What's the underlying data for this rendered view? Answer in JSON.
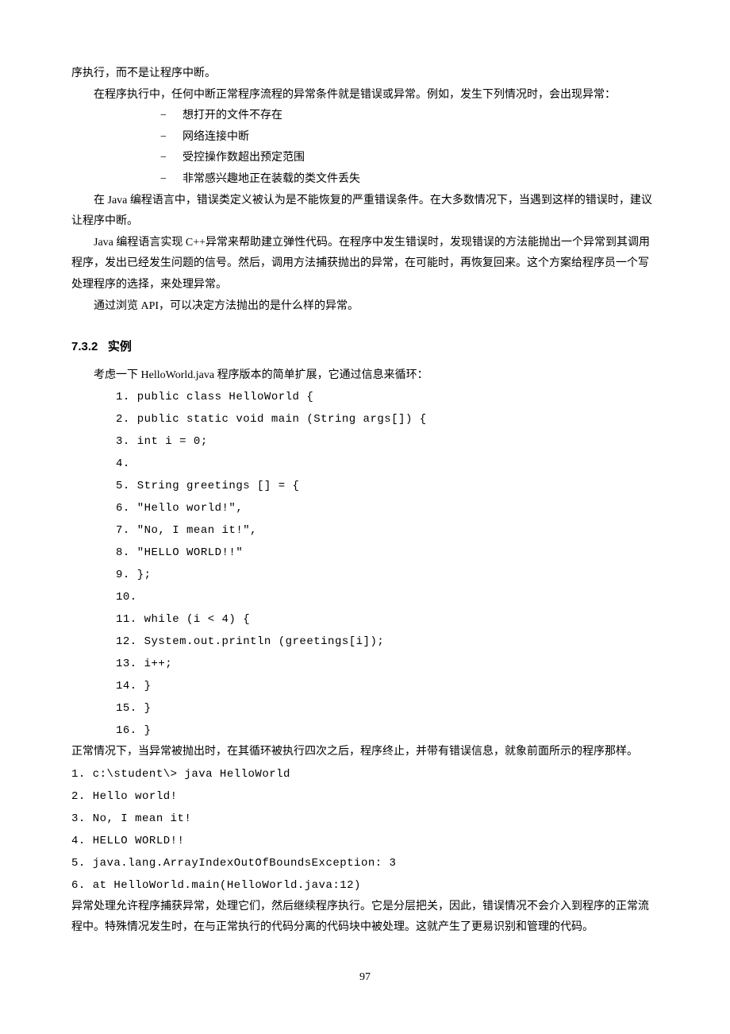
{
  "para1": "序执行，而不是让程序中断。",
  "para2": "在程序执行中，任何中断正常程序流程的异常条件就是错误或异常。例如，发生下列情况时，会出现异常：",
  "bullets": [
    "想打开的文件不存在",
    "网络连接中断",
    "受控操作数超出预定范围",
    "非常感兴趣地正在装载的类文件丢失"
  ],
  "para3": "在 Java 编程语言中，错误类定义被认为是不能恢复的严重错误条件。在大多数情况下，当遇到这样的错误时，建议让程序中断。",
  "para4": "Java 编程语言实现 C++异常来帮助建立弹性代码。在程序中发生错误时，发现错误的方法能抛出一个异常到其调用程序，发出已经发生问题的信号。然后，调用方法捕获抛出的异常，在可能时，再恢复回来。这个方案给程序员一个写处理程序的选择，来处理异常。",
  "para5": "通过浏览 API，可以决定方法抛出的是什么样的异常。",
  "sectionNumber": "7.3.2",
  "sectionTitle": "实例",
  "para6": "考虑一下 HelloWorld.java 程序版本的简单扩展，它通过信息来循环：",
  "code1": [
    "1.  public class HelloWorld {",
    "2.    public static void main (String args[]) {",
    "3.      int i = 0;",
    "4.",
    "5.      String greetings [] = {",
    "6.        \"Hello world!\",",
    "7.        \"No, I mean it!\",",
    "8.        \"HELLO WORLD!!\"",
    "9.      };",
    "10.",
    "11.     while (i < 4) {",
    "12.       System.out.println (greetings[i]);",
    "13.       i++;",
    "14.     }",
    "15.   }",
    "16. }"
  ],
  "para7": "正常情况下，当异常被抛出时，在其循环被执行四次之后，程序终止，并带有错误信息，就象前面所示的程序那样。",
  "code2": [
    "1.  c:\\student\\> java HelloWorld",
    "2.  Hello world!",
    "3.  No, I mean it!",
    "4.  HELLO WORLD!!",
    "5.  java.lang.ArrayIndexOutOfBoundsException: 3",
    "6.     at HelloWorld.main(HelloWorld.java:12)"
  ],
  "para8": "异常处理允许程序捕获异常，处理它们，然后继续程序执行。它是分层把关，因此，错误情况不会介入到程序的正常流程中。特殊情况发生时，在与正常执行的代码分离的代码块中被处理。这就产生了更易识别和管理的代码。",
  "pageNumber": "97"
}
